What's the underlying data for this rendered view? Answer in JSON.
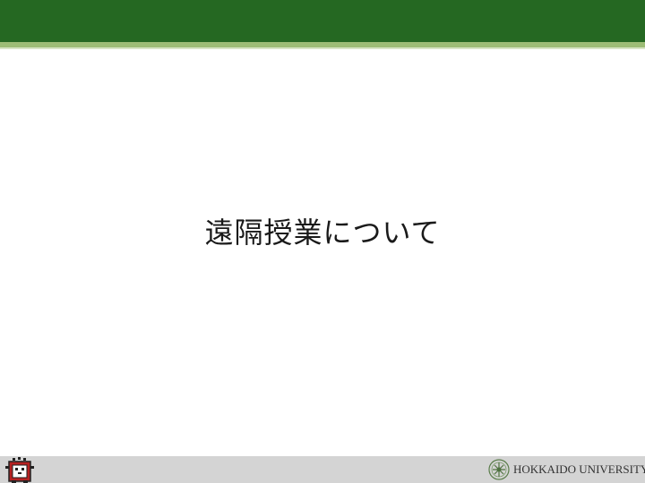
{
  "slide": {
    "title": "遠隔授業について"
  },
  "footer": {
    "university_name": "HOKKAIDO UNIVERSITY"
  },
  "colors": {
    "header_green": "#256822",
    "header_stripe": "#9dbd76",
    "footer_gray": "#d4d4d4"
  },
  "icons": {
    "mascot": "mascot-icon",
    "emblem": "university-emblem-icon"
  }
}
